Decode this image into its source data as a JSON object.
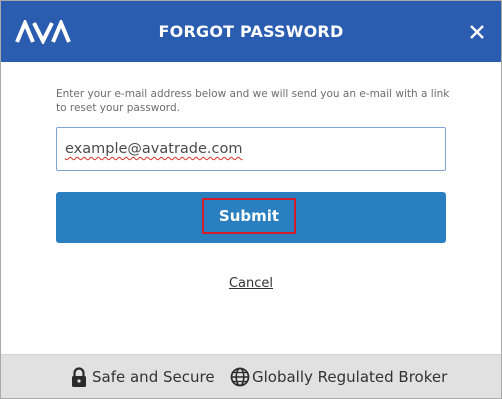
{
  "header": {
    "logo_text": "AVA",
    "title": "FORGOT PASSWORD",
    "close_icon": "close-icon",
    "background": "#2a5db0"
  },
  "form": {
    "instructions": "Enter your e-mail address below and we will send you an e-mail with a link to reset your password.",
    "email_value": "example@avatrade.com",
    "submit_label": "Submit",
    "submit_color": "#2a7fc0",
    "cancel_label": "Cancel"
  },
  "footer": {
    "badges": [
      {
        "icon": "lock-icon",
        "label": "Safe and Secure"
      },
      {
        "icon": "globe-icon",
        "label": "Globally Regulated Broker"
      }
    ]
  }
}
